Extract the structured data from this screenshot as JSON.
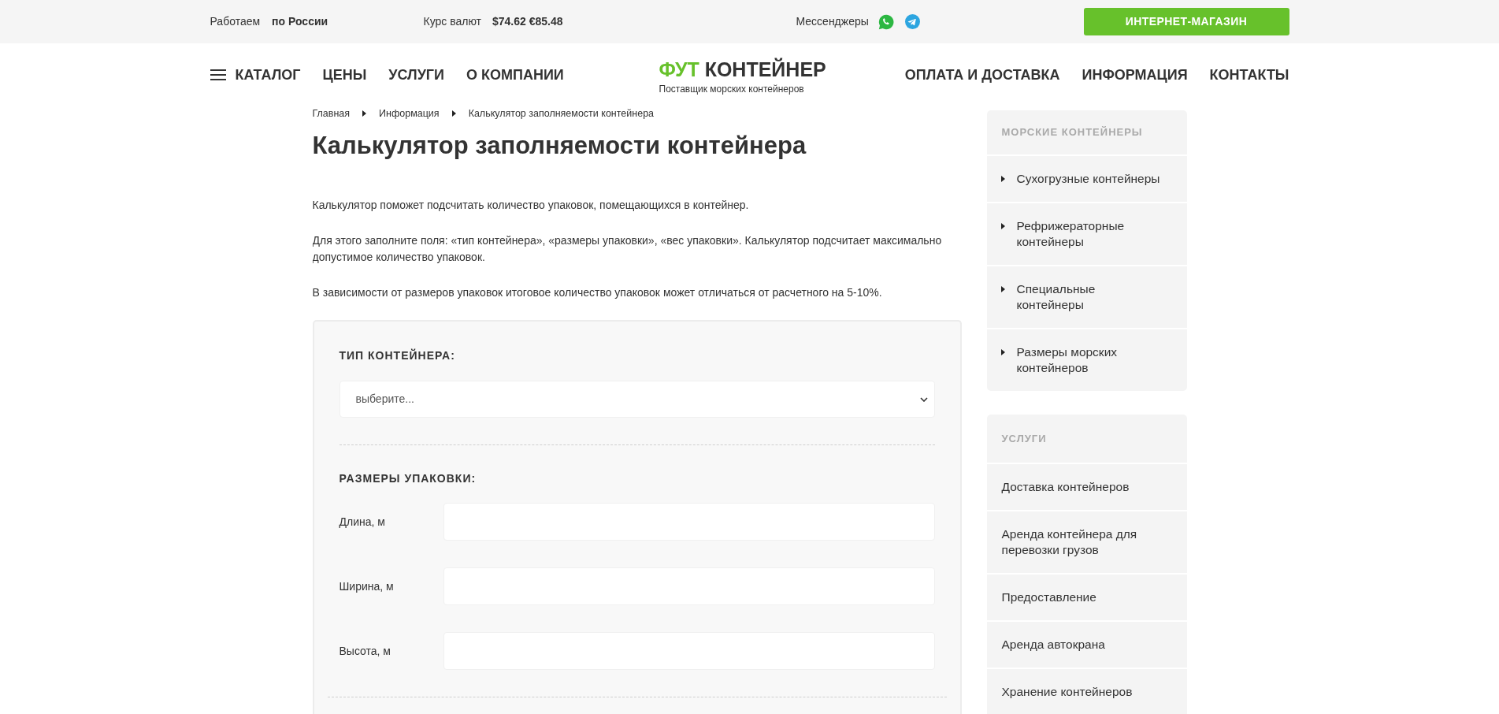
{
  "top_bar": {
    "region": {
      "label": "Работаем",
      "value": "по России"
    },
    "currency": {
      "label": "Курс валют",
      "value": "$74.62 €85.48"
    },
    "messengers": {
      "label": "Мессенджеры"
    },
    "shop_button": "ИНТЕРНЕТ-МАГАЗИН"
  },
  "header": {
    "catalog": "КАТАЛОГ",
    "nav_left": [
      "ЦЕНЫ",
      "УСЛУГИ",
      "О КОМПАНИИ"
    ],
    "logo": {
      "accent": "ФУТ",
      "name": "КОНТЕЙНЕР",
      "tagline": "Поставщик морских контейнеров"
    },
    "nav_right": [
      "ОПЛАТА И ДОСТАВКА",
      "ИНФОРМАЦИЯ",
      "КОНТАКТЫ"
    ]
  },
  "breadcrumbs": [
    "Главная",
    "Информация",
    "Калькулятор заполняемости контейнера"
  ],
  "page_title": "Калькулятор заполняемости контейнера",
  "intro": [
    "Калькулятор поможет подсчитать количество упаковок, помещающихся в контейнер.",
    "Для этого заполните поля: «тип контейнера», «размеры упаковки», «вес упаковки». Калькулятор подсчитает максимально допустимое количество упаковок.",
    "В зависимости от размеров упаковок итоговое количество упаковок может отличаться от расчетного на 5-10%."
  ],
  "calculator": {
    "container_type": {
      "label": "ТИП КОНТЕЙНЕРА:",
      "select": {
        "value": "выберите..."
      }
    },
    "dimensions": {
      "label": "РАЗМЕРЫ УПАКОВКИ:",
      "fields": [
        {
          "label": "Длина, м"
        },
        {
          "label": "Ширина, м"
        },
        {
          "label": "Высота, м"
        }
      ]
    }
  },
  "sidebar": [
    {
      "title": "МОРСКИЕ КОНТЕЙНЕРЫ",
      "items": [
        {
          "label": "Сухогрузные контейнеры",
          "kind": "submenu"
        },
        {
          "label": "Рефрижераторные контейнеры",
          "kind": "submenu"
        },
        {
          "label": "Специальные контейнеры",
          "kind": "submenu"
        },
        {
          "label": "Размеры морских контейнеров",
          "kind": "submenu"
        }
      ]
    },
    {
      "title": "УСЛУГИ",
      "items": [
        {
          "label": "Доставка контейнеров",
          "kind": "link"
        },
        {
          "label": "Аренда контейнера для перевозки грузов",
          "kind": "link"
        },
        {
          "label": "Предоставление",
          "kind": "link"
        },
        {
          "label": "Аренда автокрана",
          "kind": "link"
        },
        {
          "label": "Хранение контейнеров",
          "kind": "link"
        }
      ]
    }
  ]
}
